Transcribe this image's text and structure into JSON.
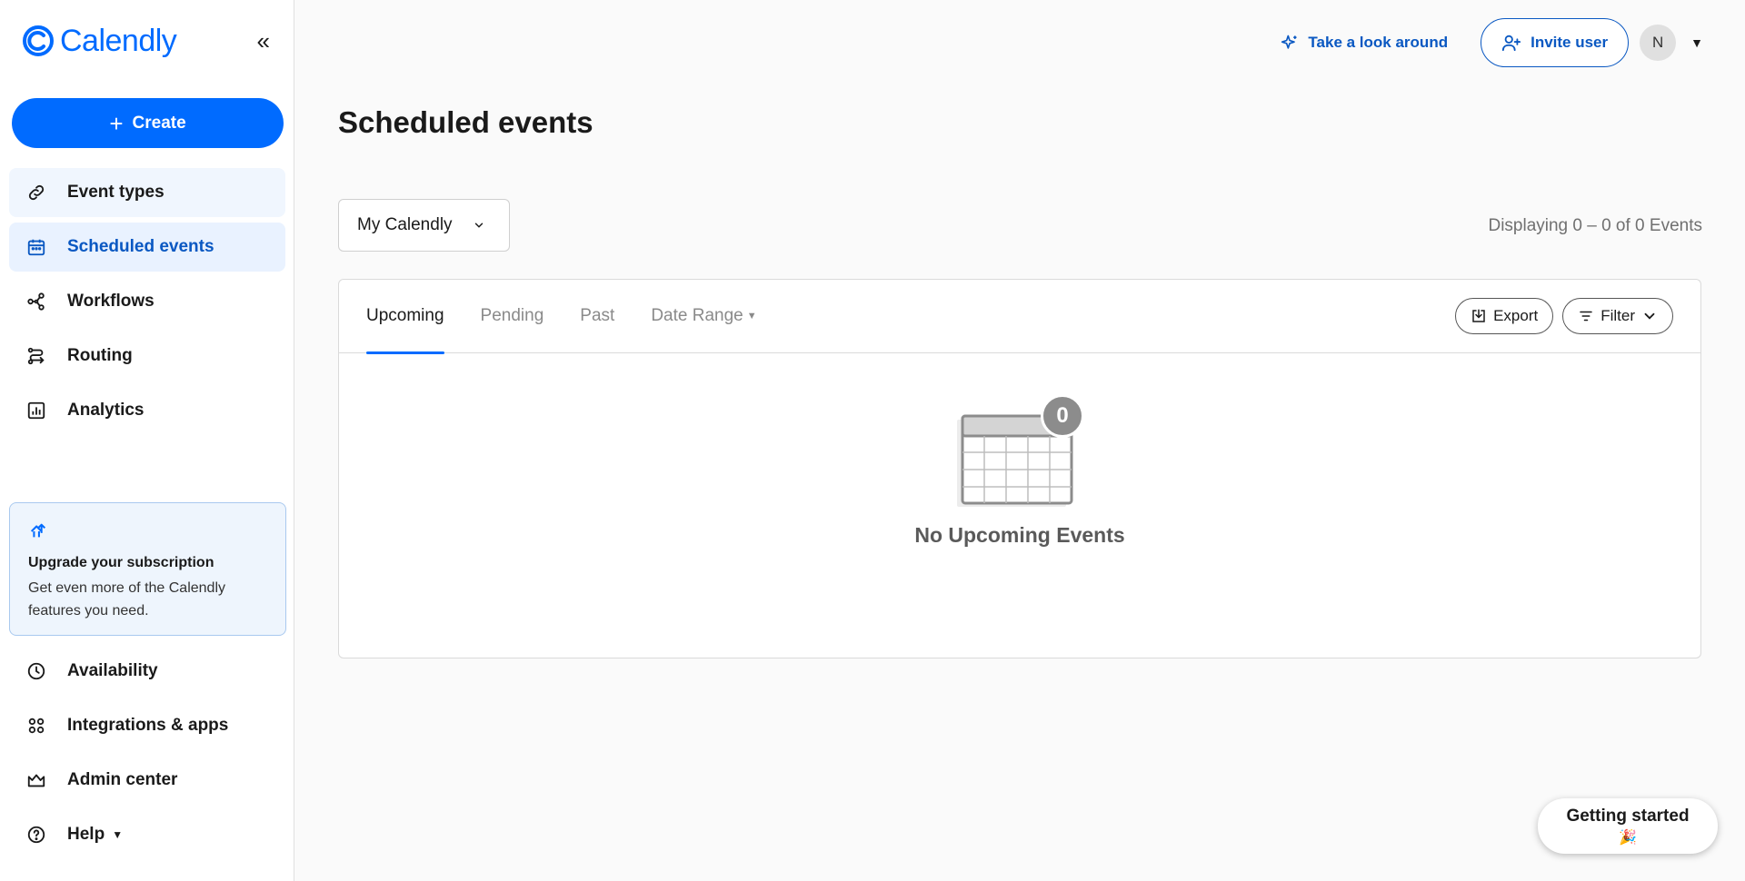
{
  "brand": {
    "name": "Calendly",
    "color": "#006bff"
  },
  "sidebar": {
    "collapse_glyph": "«",
    "create_label": "Create",
    "nav_top": [
      {
        "label": "Event types",
        "icon": "link-icon"
      },
      {
        "label": "Scheduled events",
        "icon": "calendar-icon"
      },
      {
        "label": "Workflows",
        "icon": "workflow-icon"
      },
      {
        "label": "Routing",
        "icon": "routing-icon"
      },
      {
        "label": "Analytics",
        "icon": "analytics-icon"
      }
    ],
    "upgrade": {
      "title": "Upgrade your subscription",
      "desc": "Get even more of the Calendly features you need."
    },
    "nav_bottom": [
      {
        "label": "Availability",
        "icon": "clock-icon"
      },
      {
        "label": "Integrations & apps",
        "icon": "apps-grid-icon"
      },
      {
        "label": "Admin center",
        "icon": "crown-icon"
      },
      {
        "label": "Help",
        "icon": "help-icon"
      }
    ]
  },
  "header": {
    "look_around": "Take a look around",
    "invite": "Invite user",
    "avatar_initial": "N"
  },
  "main": {
    "title": "Scheduled events",
    "calendar_select": "My Calendly",
    "display_count": "Displaying 0 – 0 of 0 Events",
    "tabs": [
      "Upcoming",
      "Pending",
      "Past",
      "Date Range"
    ],
    "export_label": "Export",
    "filter_label": "Filter",
    "empty_count": "0",
    "empty_text": "No Upcoming Events"
  },
  "widget": {
    "label": "Getting started",
    "emoji": "🎉"
  }
}
